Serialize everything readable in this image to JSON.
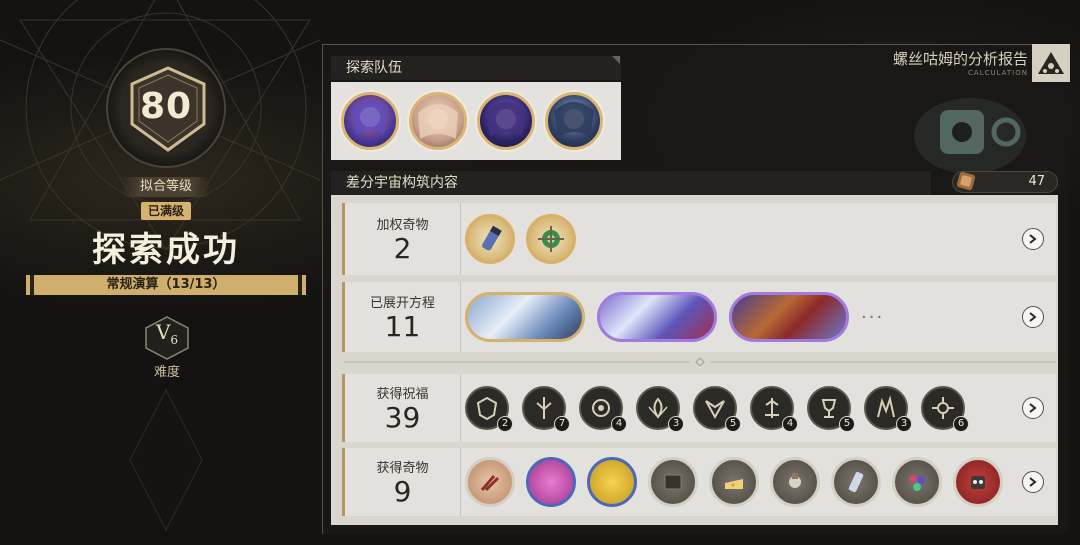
{
  "summary": {
    "level": "80",
    "grade_label": "拟合等级",
    "maxed_tag": "已满级",
    "result_title": "探索成功",
    "calc_label": "常规演算（13/13）",
    "difficulty_main": "V",
    "difficulty_sub": "6",
    "difficulty_label": "难度"
  },
  "report": {
    "title": "螺丝咕姆的分析报告",
    "subtitle": "CALCULATION"
  },
  "team": {
    "header": "探索队伍",
    "avatars": [
      {
        "icon": "character-avatar-1",
        "color": "#6a4fb0"
      },
      {
        "icon": "character-avatar-2",
        "color": "#d9b39a"
      },
      {
        "icon": "character-avatar-3",
        "color": "#4e3c8a"
      },
      {
        "icon": "character-avatar-4",
        "color": "#3b4f78"
      }
    ]
  },
  "content": {
    "header": "差分宇宙构筑内容",
    "points": "47",
    "rows": [
      {
        "label": "加权奇物",
        "count": "2"
      },
      {
        "label": "已展开方程",
        "count": "11",
        "more": "···"
      },
      {
        "label": "获得祝福",
        "count": "39",
        "blessing_counts": [
          "2",
          "7",
          "4",
          "3",
          "5",
          "4",
          "5",
          "3",
          "6"
        ]
      },
      {
        "label": "获得奇物",
        "count": "9"
      }
    ]
  },
  "colors": {
    "gold": "#d7b26f",
    "panel_light": "#e3e1dd",
    "dark_bg": "#141312"
  }
}
